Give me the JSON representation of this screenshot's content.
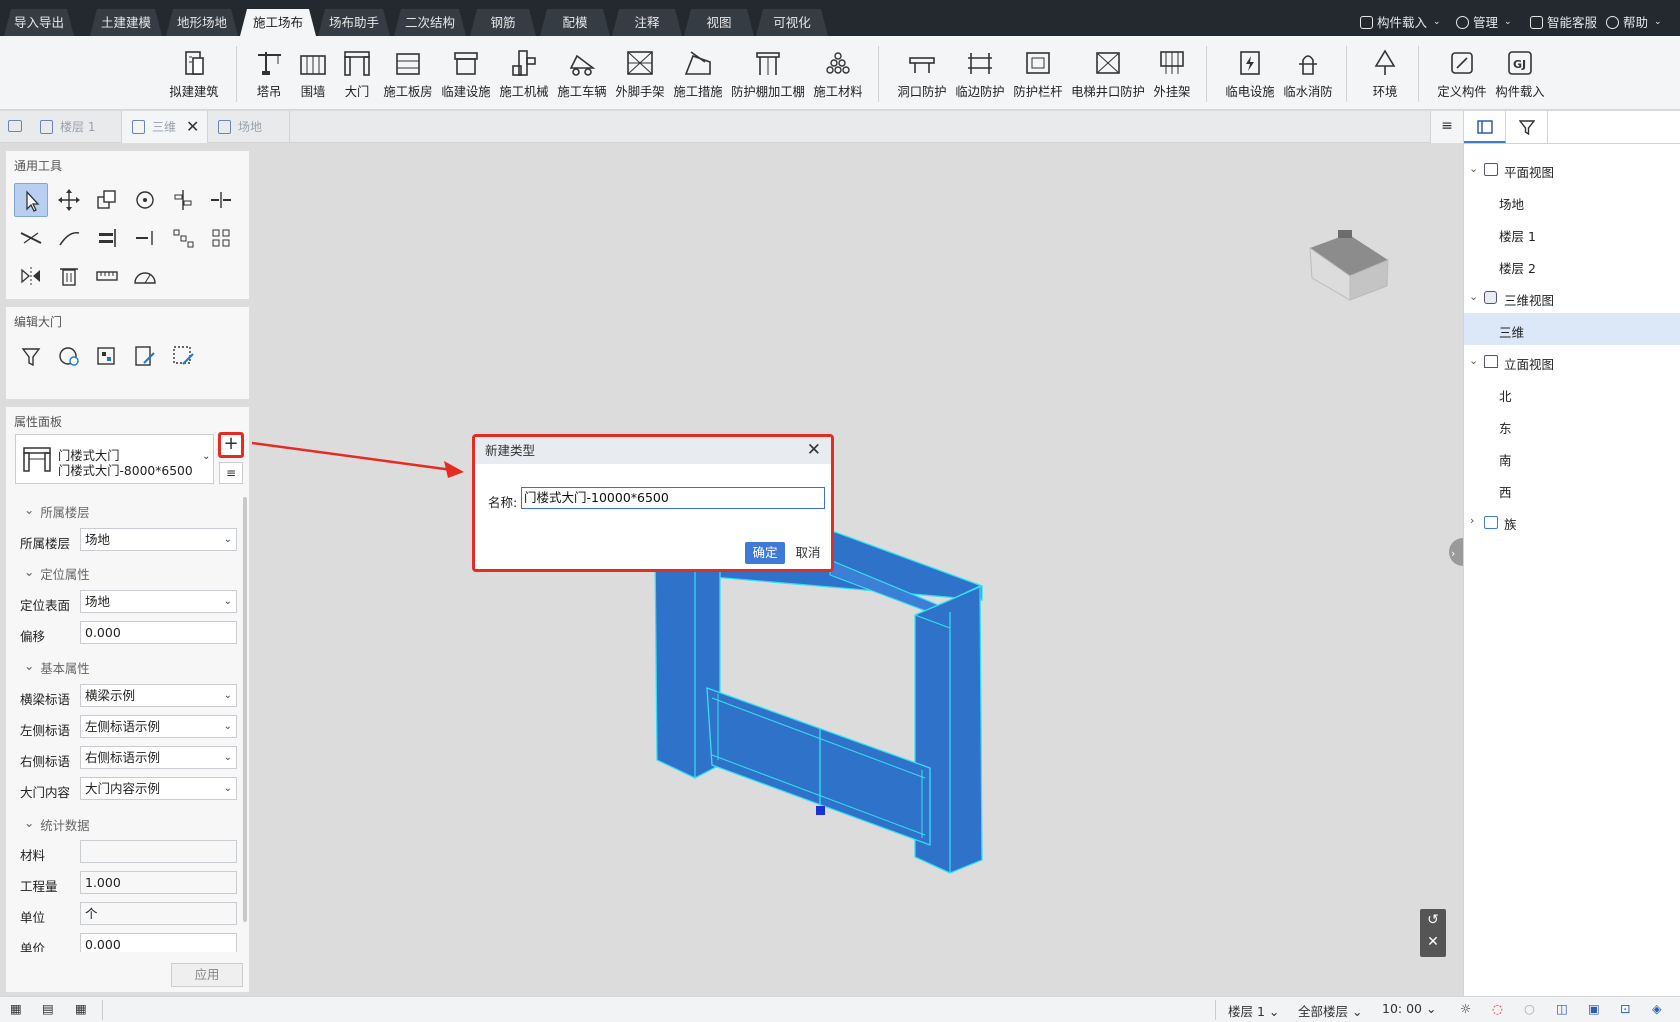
{
  "menu_tabs": [
    "导入导出",
    "土建建模",
    "地形场地",
    "施工场布",
    "场布助手",
    "二次结构",
    "钢筋",
    "配模",
    "注释",
    "视图",
    "可视化"
  ],
  "active_menu_tab": "施工场布",
  "top_right": {
    "load": "构件载入",
    "manage": "管理",
    "service": "智能客服",
    "help": "帮助"
  },
  "ribbon": {
    "groups": [
      [
        "拟建建筑"
      ],
      [
        "塔吊",
        "围墙",
        "大门",
        "施工板房",
        "临建设施",
        "施工机械",
        "施工车辆",
        "外脚手架",
        "施工措施",
        "防护棚加工棚",
        "施工材料"
      ],
      [
        "洞口防护",
        "临边防护",
        "防护栏杆",
        "电梯井口防护",
        "外挂架"
      ],
      [
        "临电设施",
        "临水消防"
      ],
      [
        "环境"
      ],
      [
        "定义构件",
        "构件载入"
      ]
    ]
  },
  "doc_tabs": [
    {
      "label": "楼层 1",
      "active": false
    },
    {
      "label": "三维",
      "active": true,
      "closable": true
    },
    {
      "label": "场地",
      "active": false
    }
  ],
  "panels": {
    "tools_title": "通用工具",
    "edit_title": "编辑大门",
    "props_title": "属性面板"
  },
  "type_selector": {
    "line1": "门楼式大门",
    "line2": "门楼式大门-8000*6500"
  },
  "properties": {
    "sections": {
      "floor": "所属楼层",
      "position": "定位属性",
      "basic": "基本属性",
      "stats": "统计数据"
    },
    "floor": {
      "label": "所属楼层",
      "value": "场地"
    },
    "surface": {
      "label": "定位表面",
      "value": "场地"
    },
    "offset": {
      "label": "偏移",
      "value": "0.000"
    },
    "beam": {
      "label": "横梁标语",
      "value": "横梁示例"
    },
    "left": {
      "label": "左侧标语",
      "value": "左侧标语示例"
    },
    "right": {
      "label": "右侧标语",
      "value": "右侧标语示例"
    },
    "content": {
      "label": "大门内容",
      "value": "大门内容示例"
    },
    "material": {
      "label": "材料",
      "value": ""
    },
    "quantity": {
      "label": "工程量",
      "value": "1.000"
    },
    "unit": {
      "label": "单位",
      "value": "个"
    },
    "price": {
      "label": "单价",
      "value": "0.000"
    },
    "apply": "应用"
  },
  "dialog": {
    "title": "新建类型",
    "name_label": "名称:",
    "name_value": "门楼式大门-10000*6500",
    "ok": "确定",
    "cancel": "取消"
  },
  "tree": {
    "plan": "平面视图",
    "plan_items": [
      "场地",
      "楼层 1",
      "楼层 2"
    ],
    "three_d": "三维视图",
    "three_d_items": [
      "三维"
    ],
    "elevation": "立面视图",
    "elevation_items": [
      "北",
      "东",
      "南",
      "西"
    ],
    "family": "族"
  },
  "status": {
    "floor": "楼层 1",
    "all_floors": "全部楼层",
    "time": "10: 00"
  },
  "colors": {
    "accent": "#3f7ad9",
    "highlight": "#e52b22",
    "gate_fill": "#2f72c9",
    "gate_edge": "#33e0f0"
  }
}
